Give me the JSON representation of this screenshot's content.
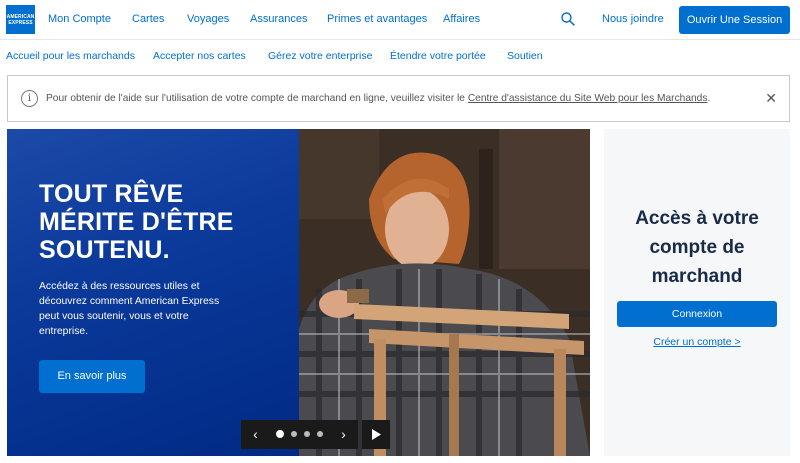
{
  "brand": {
    "logo_line1": "AMERICAN",
    "logo_line2": "EXPRESS",
    "color": "#016fd0"
  },
  "topnav": {
    "items": [
      {
        "label": "Mon Compte"
      },
      {
        "label": "Cartes"
      },
      {
        "label": "Voyages"
      },
      {
        "label": "Assurances"
      },
      {
        "label": "Primes et avantages"
      },
      {
        "label": "Affaires"
      }
    ],
    "search_icon": "search-icon",
    "contact_label": "Nous joindre",
    "login_label": "Ouvrir Une Session"
  },
  "subnav": {
    "items": [
      {
        "label": "Accueil pour les marchands"
      },
      {
        "label": "Accepter nos cartes"
      },
      {
        "label": "Gérez votre enterprise"
      },
      {
        "label": "Étendre votre portée"
      },
      {
        "label": "Soutien"
      }
    ]
  },
  "alert": {
    "icon": "info-icon",
    "text_before": "Pour obtenir de l'aide sur l'utilisation de votre compte de marchand en ligne, veuillez visiter le",
    "link_text": "Centre d'assistance du Site Web pour les Marchands",
    "text_after": ".",
    "close_icon": "close-icon"
  },
  "hero": {
    "title": "TOUT RÊVE MÉRITE D'ÊTRE SOUTENU.",
    "description": "Accédez à des ressources utiles et découvrez comment American Express peut vous soutenir, vous et votre entreprise.",
    "button_label": "En savoir plus",
    "carousel": {
      "slide_count": 4,
      "active_index": 0,
      "prev_icon": "chevron-left-icon",
      "next_icon": "chevron-right-icon",
      "play_icon": "play-icon"
    }
  },
  "access": {
    "title": "Accès à votre compte de marchand",
    "button_label": "Connexion",
    "link_text": "Créer un compte >"
  }
}
